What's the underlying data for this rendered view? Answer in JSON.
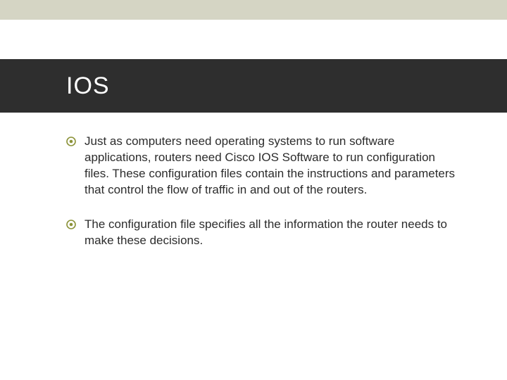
{
  "slide": {
    "title": "IOS",
    "bullets": [
      {
        "text": "Just as computers need operating systems to run software applications, routers need Cisco IOS Software to run configuration files. These configuration files contain the instructions and parameters that control the flow of traffic in and out of the routers."
      },
      {
        "text": "The configuration file specifies all the information the router needs to make these decisions."
      }
    ]
  },
  "colors": {
    "accent": "#8b9238",
    "titleBand": "#2e2e2e",
    "topBand": "#d5d5c4"
  }
}
